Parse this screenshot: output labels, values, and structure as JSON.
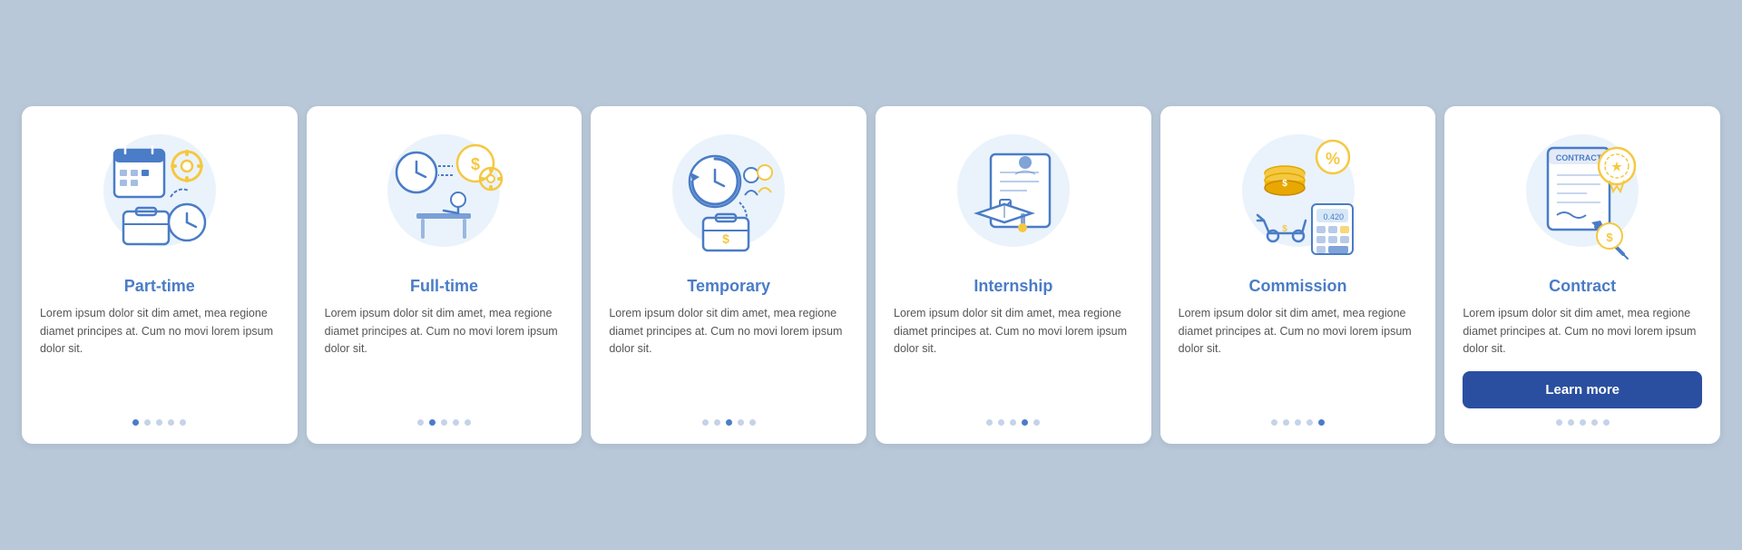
{
  "cards": [
    {
      "id": "part-time",
      "title": "Part-time",
      "body": "Lorem ipsum dolor sit dim amet, mea regione diamet principes at. Cum no movi lorem ipsum dolor sit.",
      "dots": [
        true,
        false,
        false,
        false,
        false
      ],
      "hasButton": false,
      "buttonLabel": ""
    },
    {
      "id": "full-time",
      "title": "Full-time",
      "body": "Lorem ipsum dolor sit dim amet, mea regione diamet principes at. Cum no movi lorem ipsum dolor sit.",
      "dots": [
        false,
        true,
        false,
        false,
        false
      ],
      "hasButton": false,
      "buttonLabel": ""
    },
    {
      "id": "temporary",
      "title": "Temporary",
      "body": "Lorem ipsum dolor sit dim amet, mea regione diamet principes at. Cum no movi lorem ipsum dolor sit.",
      "dots": [
        false,
        false,
        true,
        false,
        false
      ],
      "hasButton": false,
      "buttonLabel": ""
    },
    {
      "id": "internship",
      "title": "Internship",
      "body": "Lorem ipsum dolor sit dim amet, mea regione diamet principes at. Cum no movi lorem ipsum dolor sit.",
      "dots": [
        false,
        false,
        false,
        true,
        false
      ],
      "hasButton": false,
      "buttonLabel": ""
    },
    {
      "id": "commission",
      "title": "Commission",
      "body": "Lorem ipsum dolor sit dim amet, mea regione diamet principes at. Cum no movi lorem ipsum dolor sit.",
      "dots": [
        false,
        false,
        false,
        false,
        true
      ],
      "hasButton": false,
      "buttonLabel": ""
    },
    {
      "id": "contract",
      "title": "Contract",
      "body": "Lorem ipsum dolor sit dim amet, mea regione diamet principes at. Cum no movi lorem ipsum dolor sit.",
      "dots": [
        false,
        false,
        false,
        false,
        false
      ],
      "hasButton": true,
      "buttonLabel": "Learn more"
    }
  ],
  "colors": {
    "accent": "#4a7cc7",
    "dark_blue": "#2a4fa0",
    "circle_bg": "#d6e8f7",
    "icon_yellow": "#f5c842",
    "icon_blue": "#4a7cc7",
    "icon_dark": "#2a4fa0"
  }
}
